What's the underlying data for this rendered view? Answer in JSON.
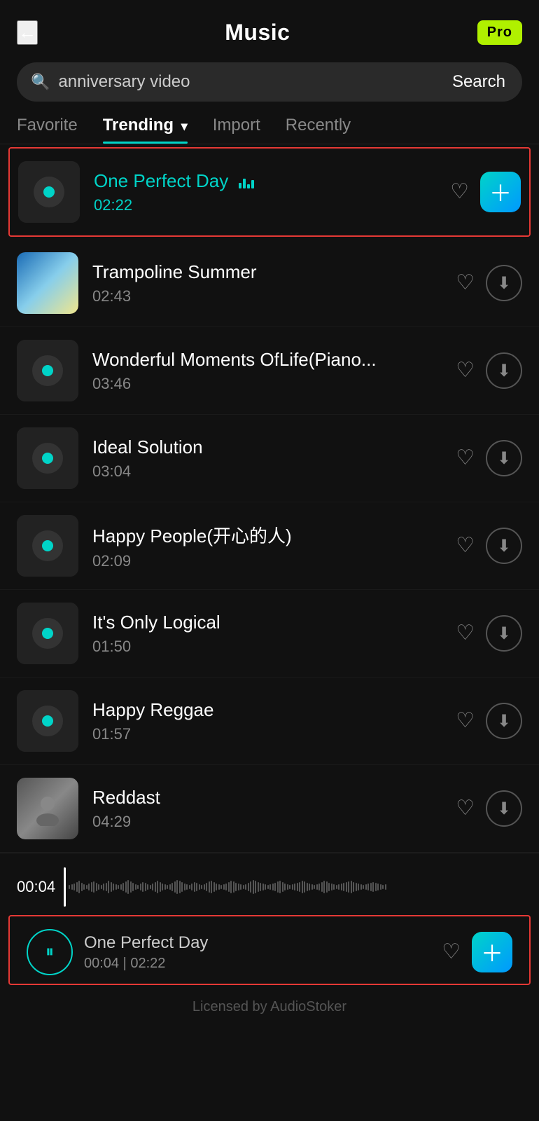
{
  "header": {
    "title": "Music",
    "back_label": "←",
    "pro_label": "Pro"
  },
  "search": {
    "placeholder": "anniversary video",
    "search_button": "Search"
  },
  "tabs": [
    {
      "id": "favorite",
      "label": "Favorite",
      "active": false
    },
    {
      "id": "trending",
      "label": "Trending",
      "active": true
    },
    {
      "id": "import",
      "label": "Import",
      "active": false
    },
    {
      "id": "recently",
      "label": "Recently",
      "active": false
    }
  ],
  "tracks": [
    {
      "id": 1,
      "title": "One Perfect Day",
      "duration": "02:22",
      "active": true,
      "thumb_type": "vinyl",
      "has_bars": true
    },
    {
      "id": 2,
      "title": "Trampoline Summer",
      "duration": "02:43",
      "active": false,
      "thumb_type": "beach"
    },
    {
      "id": 3,
      "title": "Wonderful Moments OfLife(Piano...",
      "duration": "03:46",
      "active": false,
      "thumb_type": "vinyl"
    },
    {
      "id": 4,
      "title": "Ideal Solution",
      "duration": "03:04",
      "active": false,
      "thumb_type": "vinyl"
    },
    {
      "id": 5,
      "title": "Happy People(开心的人)",
      "duration": "02:09",
      "active": false,
      "thumb_type": "vinyl"
    },
    {
      "id": 6,
      "title": "It's Only Logical",
      "duration": "01:50",
      "active": false,
      "thumb_type": "vinyl"
    },
    {
      "id": 7,
      "title": "Happy Reggae",
      "duration": "01:57",
      "active": false,
      "thumb_type": "vinyl"
    },
    {
      "id": 8,
      "title": "Reddast",
      "duration": "04:29",
      "active": false,
      "thumb_type": "person"
    }
  ],
  "player": {
    "current_time": "00:04",
    "total_time": "02:22",
    "track_name": "One Perfect Day",
    "time_display": "00:04 | 02:22"
  },
  "footer": {
    "credit": "Licensed by AudioStoker"
  }
}
